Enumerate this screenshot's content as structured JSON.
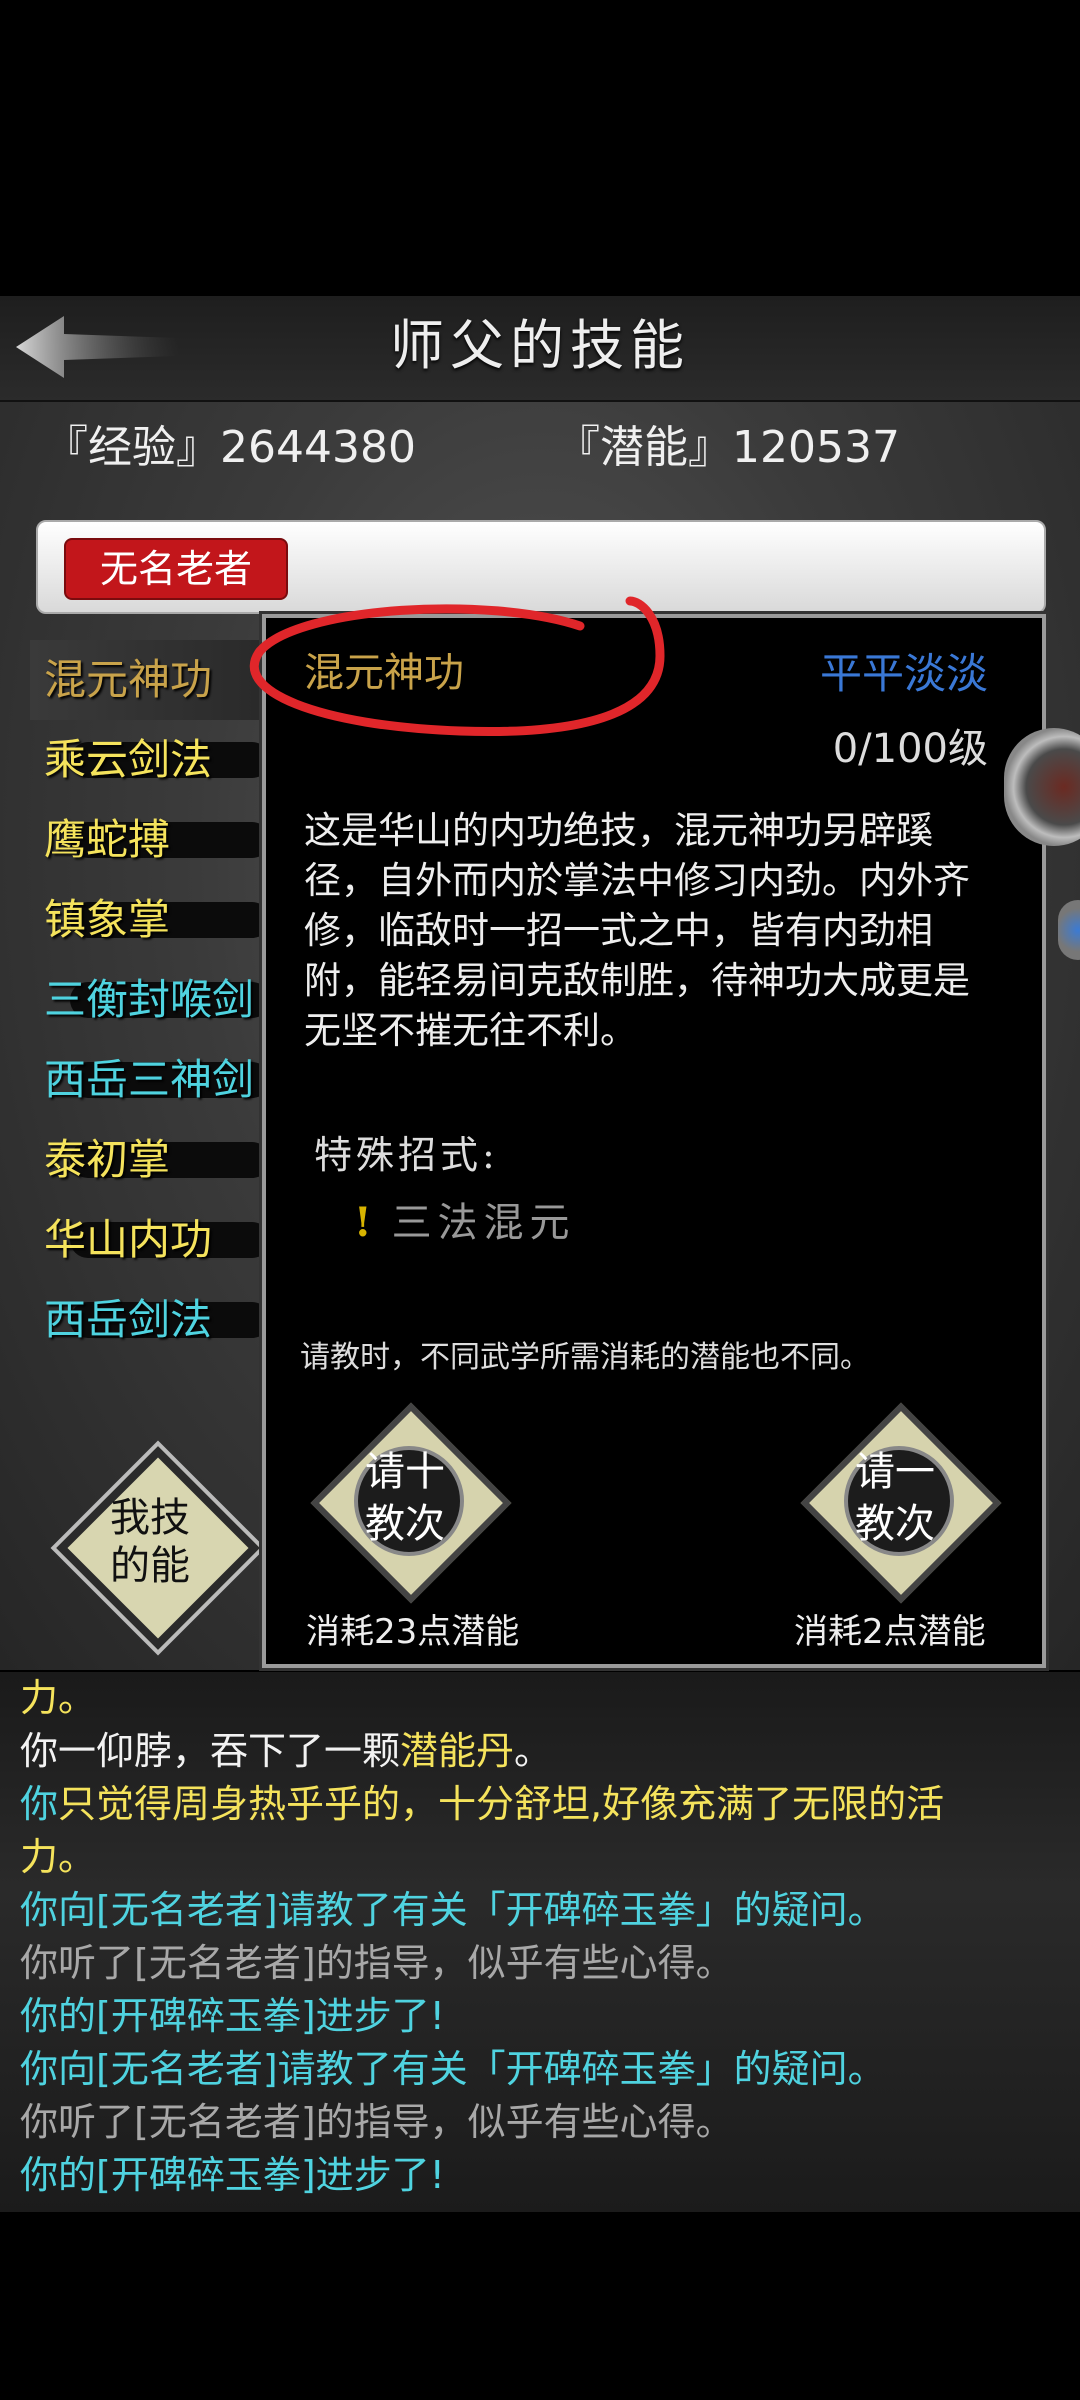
{
  "header": {
    "title": "师父的技能"
  },
  "stats": {
    "exp": "『经验』2644380",
    "potential": "『潜能』120537"
  },
  "master": {
    "name": "无名老者"
  },
  "skills": [
    {
      "label": "混元神功",
      "color": "#c9a34a"
    },
    {
      "label": "乘云剑法",
      "color": "#f5e35c"
    },
    {
      "label": "鹰蛇搏",
      "color": "#f5e35c"
    },
    {
      "label": "镇象掌",
      "color": "#f5e35c"
    },
    {
      "label": "三衡封喉剑",
      "color": "#4fd3e0"
    },
    {
      "label": "西岳三神剑",
      "color": "#4fd3e0"
    },
    {
      "label": "泰初掌",
      "color": "#f5e35c"
    },
    {
      "label": "华山内功",
      "color": "#f5e35c"
    },
    {
      "label": "西岳剑法",
      "color": "#4fd3e0"
    }
  ],
  "my_skill_button": {
    "line1": "我技",
    "line2": "的能"
  },
  "detail": {
    "name": "混元神功",
    "grade": "平平淡淡",
    "level": "0/100级",
    "description": "这是华山的内功绝技，混元神功另辟蹊径，自外而内於掌法中修习内劲。内外齐修，临敌时一招一式之中，皆有内劲相附，能轻易间克敌制胜，待神功大成更是无坚不摧无往不利。",
    "special_label": "特殊招式:",
    "special_mark": "!",
    "special_move": "三法混元",
    "note": "请教时，不同武学所需消耗的潜能也不同。",
    "btn_ten": {
      "line1": "请十",
      "line2": "教次"
    },
    "btn_one": {
      "line1": "请一",
      "line2": "教次"
    },
    "cost_ten": "消耗23点潜能",
    "cost_one": "消耗2点潜能"
  },
  "log": [
    [
      {
        "t": "力。",
        "c": "yellow"
      }
    ],
    [
      {
        "t": "你一仰脖，吞下了一颗",
        "c": "white"
      },
      {
        "t": "潜能丹",
        "c": "yellow"
      },
      {
        "t": "。",
        "c": "white"
      }
    ],
    [
      {
        "t": "你",
        "c": "cyan"
      },
      {
        "t": "只觉得周身热乎乎的，十分舒坦,好像充满了无限的活",
        "c": "yellow"
      }
    ],
    [
      {
        "t": "力。",
        "c": "yellow"
      }
    ],
    [
      {
        "t": "你向[无名老者]请教了有关「开碑碎玉拳」的疑问。",
        "c": "cyan"
      }
    ],
    [
      {
        "t": "你听了[无名老者]的指导，似乎有些心得。",
        "c": "gray"
      }
    ],
    [
      {
        "t": "你的[开碑碎玉拳]进步了!",
        "c": "cyan"
      }
    ],
    [
      {
        "t": "你向[无名老者]请教了有关「开碑碎玉拳」的疑问。",
        "c": "cyan"
      }
    ],
    [
      {
        "t": "你听了[无名老者]的指导，似乎有些心得。",
        "c": "gray"
      }
    ],
    [
      {
        "t": "你的[开碑碎玉拳]进步了!",
        "c": "cyan"
      }
    ]
  ]
}
